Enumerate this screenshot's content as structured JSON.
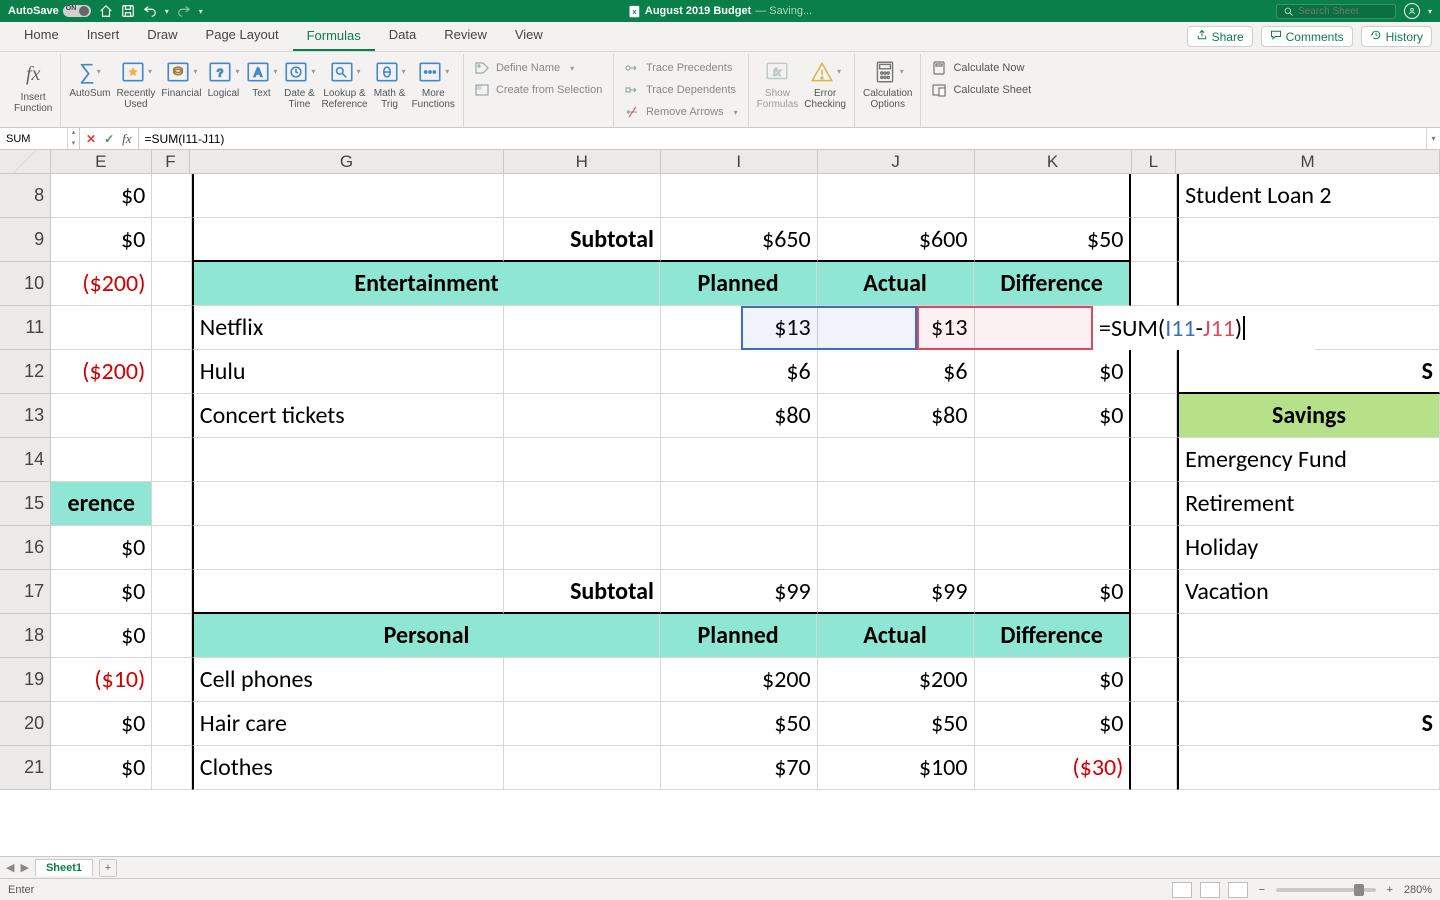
{
  "titlebar": {
    "autosave_label": "AutoSave",
    "autosave_on": "ON",
    "doc_title": "August 2019 Budget",
    "doc_status": "— Saving...",
    "search_placeholder": "Search Sheet"
  },
  "tabs": {
    "items": [
      "Home",
      "Insert",
      "Draw",
      "Page Layout",
      "Formulas",
      "Data",
      "Review",
      "View"
    ],
    "active": "Formulas",
    "share": "Share",
    "comments": "Comments",
    "history": "History"
  },
  "ribbon": {
    "insert_function": "Insert\nFunction",
    "autosum": "AutoSum",
    "recently_used": "Recently\nUsed",
    "financial": "Financial",
    "logical": "Logical",
    "text": "Text",
    "date_time": "Date &\nTime",
    "lookup_ref": "Lookup &\nReference",
    "math_trig": "Math &\nTrig",
    "more_fn": "More\nFunctions",
    "define_name": "Define Name",
    "create_from_sel": "Create from Selection",
    "trace_prec": "Trace Precedents",
    "trace_dep": "Trace Dependents",
    "remove_arrows": "Remove Arrows",
    "show_formulas": "Show\nFormulas",
    "error_check": "Error\nChecking",
    "calc_opts": "Calculation\nOptions",
    "calc_now": "Calculate Now",
    "calc_sheet": "Calculate Sheet"
  },
  "formula_bar": {
    "name": "SUM",
    "formula": "=SUM(I11-J11)"
  },
  "columns": {
    "E": 113,
    "F": 43,
    "G": 352,
    "H": 176,
    "I": 176,
    "J": 176,
    "K": 176,
    "L": 50,
    "M": 296
  },
  "row_heads": [
    "8",
    "9",
    "10",
    "11",
    "12",
    "13",
    "14",
    "15",
    "16",
    "17",
    "18",
    "19",
    "20",
    "21"
  ],
  "cells": {
    "r8": {
      "E": "$0",
      "M": "Student Loan 2"
    },
    "r9": {
      "E": "$0",
      "H": "Subtotal",
      "I": "$650",
      "J": "$600",
      "K": "$50"
    },
    "r10": {
      "E": "($200)",
      "G": "Entertainment",
      "I": "Planned",
      "J": "Actual",
      "K": "Difference"
    },
    "r11": {
      "G": "Netflix",
      "I": "$13",
      "J": "$13",
      "K_formula": "=SUM(I11-J11)"
    },
    "r12": {
      "E": "($200)",
      "G": "Hulu",
      "I": "$6",
      "J": "$6",
      "K": "$0",
      "M": "S"
    },
    "r13": {
      "G": "Concert tickets",
      "I": "$80",
      "J": "$80",
      "K": "$0",
      "M": "Savings"
    },
    "r14": {
      "M": "Emergency Fund"
    },
    "r15": {
      "E": "erence",
      "M": "Retirement"
    },
    "r16": {
      "E": "$0",
      "M": "Holiday"
    },
    "r17": {
      "E": "$0",
      "H": "Subtotal",
      "I": "$99",
      "J": "$99",
      "K": "$0",
      "M": "Vacation"
    },
    "r18": {
      "E": "$0",
      "G": "Personal",
      "I": "Planned",
      "J": "Actual",
      "K": "Difference"
    },
    "r19": {
      "E": "($10)",
      "G": "Cell phones",
      "I": "$200",
      "J": "$200",
      "K": "$0"
    },
    "r20": {
      "E": "$0",
      "G": "Hair care",
      "I": "$50",
      "J": "$50",
      "K": "$0",
      "M": "S"
    },
    "r21": {
      "E": "$0",
      "G": "Clothes",
      "I": "$70",
      "J": "$100",
      "K": "($30)"
    }
  },
  "edit_cell": {
    "pre": "=SUM(",
    "a": "I11",
    "mid": "-",
    "b": "J11",
    "post": ")"
  },
  "sheet_tabs": {
    "name": "Sheet1"
  },
  "status": {
    "mode": "Enter",
    "zoom": "280%"
  }
}
